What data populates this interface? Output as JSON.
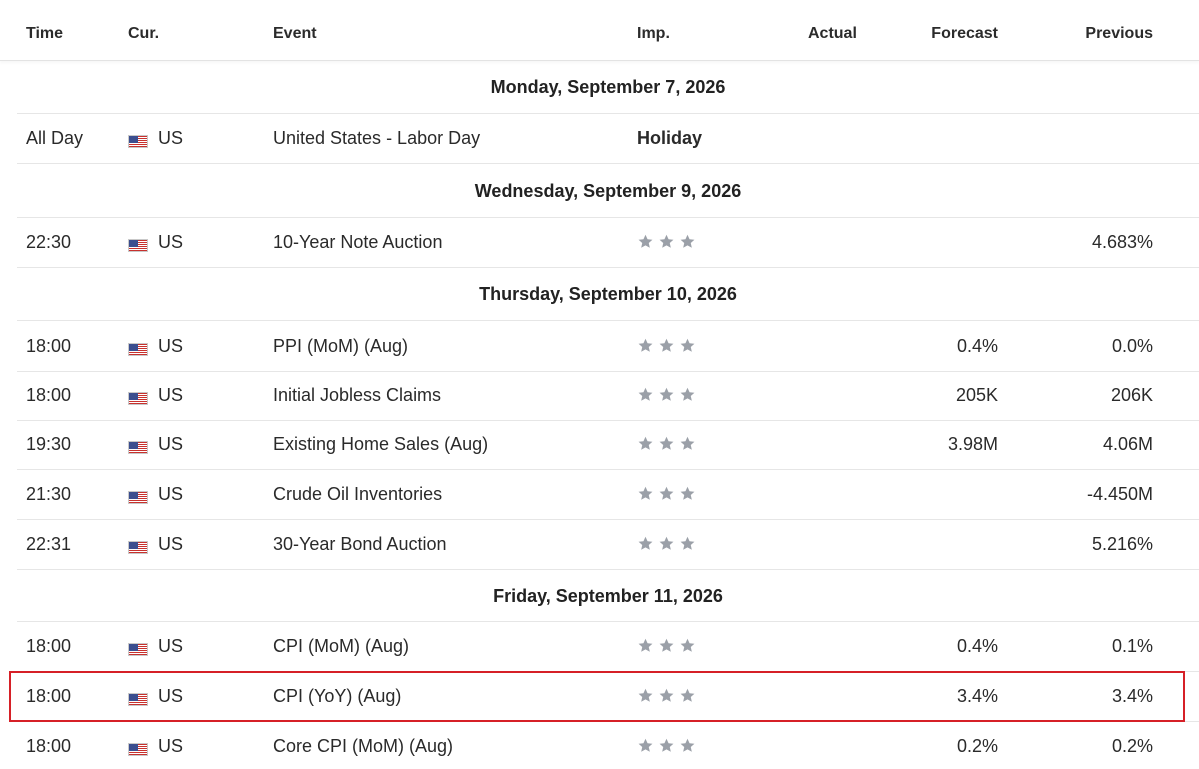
{
  "columns": {
    "time": "Time",
    "cur": "Cur.",
    "event": "Event",
    "imp": "Imp.",
    "actual": "Actual",
    "forecast": "Forecast",
    "previous": "Previous"
  },
  "colors": {
    "star": "#9ba0a8",
    "highlight_border": "#d62027",
    "row_divider": "#e6e6e6"
  },
  "days": [
    {
      "label": "Monday, September 7, 2026",
      "events": [
        {
          "time": "All Day",
          "cur": "US",
          "flag": "us-flag-icon",
          "event": "United States - Labor Day",
          "imp_text": "Holiday",
          "actual": "",
          "forecast": "",
          "previous": ""
        }
      ]
    },
    {
      "label": "Wednesday, September 9, 2026",
      "events": [
        {
          "time": "22:30",
          "cur": "US",
          "flag": "us-flag-icon",
          "event": "10-Year Note Auction",
          "imp_stars": 3,
          "actual": "",
          "forecast": "",
          "previous": "4.683%"
        }
      ]
    },
    {
      "label": "Thursday, September 10, 2026",
      "events": [
        {
          "time": "18:00",
          "cur": "US",
          "flag": "us-flag-icon",
          "event": "PPI (MoM) (Aug)",
          "imp_stars": 3,
          "actual": "",
          "forecast": "0.4%",
          "previous": "0.0%"
        },
        {
          "time": "18:00",
          "cur": "US",
          "flag": "us-flag-icon",
          "event": "Initial Jobless Claims",
          "imp_stars": 3,
          "actual": "",
          "forecast": "205K",
          "previous": "206K"
        },
        {
          "time": "19:30",
          "cur": "US",
          "flag": "us-flag-icon",
          "event": "Existing Home Sales  (Aug)",
          "imp_stars": 3,
          "actual": "",
          "forecast": "3.98M",
          "previous": "4.06M"
        },
        {
          "time": "21:30",
          "cur": "US",
          "flag": "us-flag-icon",
          "event": "Crude Oil Inventories",
          "imp_stars": 3,
          "actual": "",
          "forecast": "",
          "previous": "-4.450M"
        },
        {
          "time": "22:31",
          "cur": "US",
          "flag": "us-flag-icon",
          "event": "30-Year Bond Auction",
          "imp_stars": 3,
          "actual": "",
          "forecast": "",
          "previous": "5.216%"
        }
      ]
    },
    {
      "label": "Friday, September 11, 2026",
      "events": [
        {
          "time": "18:00",
          "cur": "US",
          "flag": "us-flag-icon",
          "event": "CPI (MoM) (Aug)",
          "imp_stars": 3,
          "actual": "",
          "forecast": "0.4%",
          "previous": "0.1%"
        },
        {
          "time": "18:00",
          "cur": "US",
          "flag": "us-flag-icon",
          "event": "CPI (YoY) (Aug)",
          "imp_stars": 3,
          "actual": "",
          "forecast": "3.4%",
          "previous": "3.4%",
          "highlighted": true
        },
        {
          "time": "18:00",
          "cur": "US",
          "flag": "us-flag-icon",
          "event": "Core CPI (MoM) (Aug)",
          "imp_stars": 3,
          "actual": "",
          "forecast": "0.2%",
          "previous": "0.2%"
        }
      ]
    }
  ]
}
